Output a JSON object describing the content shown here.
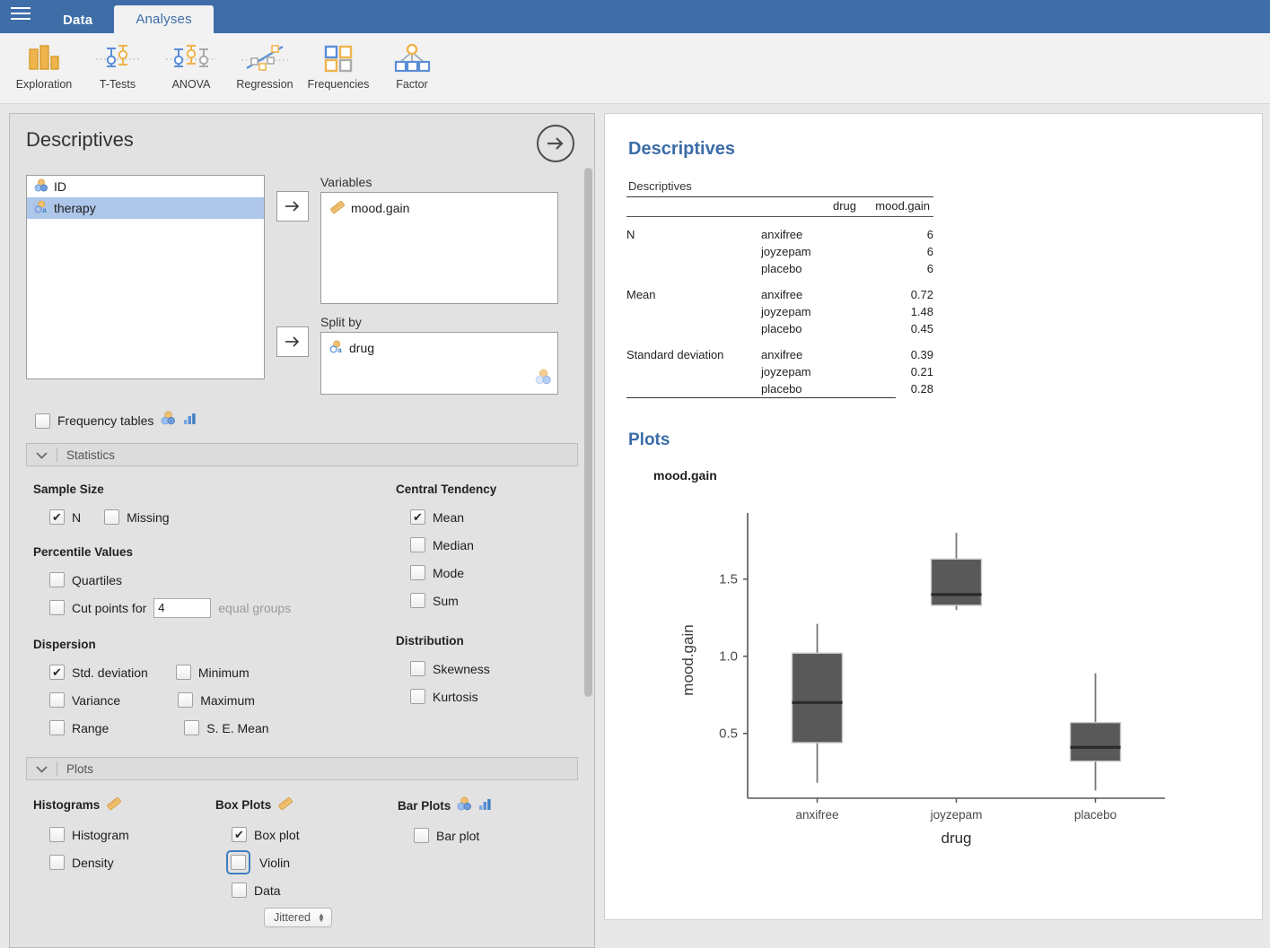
{
  "titlebar": {
    "menu_icon": "hamburger-icon",
    "tabs": [
      {
        "label": "Data",
        "active": false
      },
      {
        "label": "Analyses",
        "active": true
      }
    ]
  },
  "ribbon": {
    "buttons": [
      {
        "label": "Exploration",
        "icon": "bar-chart-icon"
      },
      {
        "label": "T-Tests",
        "icon": "error-bars-two-icon"
      },
      {
        "label": "ANOVA",
        "icon": "error-bars-three-icon"
      },
      {
        "label": "Regression",
        "icon": "scatter-line-icon"
      },
      {
        "label": "Frequencies",
        "icon": "four-squares-icon"
      },
      {
        "label": "Factor",
        "icon": "factor-tree-icon"
      }
    ]
  },
  "options": {
    "title": "Descriptives",
    "forward_icon": "arrow-right-circle-icon",
    "available_variables": [
      {
        "name": "ID",
        "type_icon": "nominal-icon",
        "selected": false
      },
      {
        "name": "therapy",
        "type_icon": "nominal-text-icon",
        "selected": true
      }
    ],
    "variables_box": {
      "label": "Variables",
      "items": [
        {
          "name": "mood.gain",
          "type_icon": "continuous-icon"
        }
      ]
    },
    "split_by_box": {
      "label": "Split by",
      "items": [
        {
          "name": "drug",
          "type_icon": "nominal-text-icon"
        }
      ],
      "permitted_icon": "nominal-icon"
    },
    "frequency_tables": {
      "label": "Frequency tables",
      "checked": false,
      "icons": [
        "nominal-icon",
        "bar-chart-small-icon"
      ]
    },
    "sections": {
      "statistics": {
        "label": "Statistics",
        "chevron": "chevron-down-icon",
        "expanded": true
      },
      "plots": {
        "label": "Plots",
        "chevron": "chevron-down-icon",
        "expanded": true
      }
    },
    "statistics": {
      "sample_size": {
        "title": "Sample Size",
        "items": [
          {
            "label": "N",
            "checked": true
          },
          {
            "label": "Missing",
            "checked": false
          }
        ]
      },
      "percentile_values": {
        "title": "Percentile Values",
        "items": [
          {
            "label": "Quartiles",
            "checked": false
          },
          {
            "label": "Cut points for",
            "checked": false
          }
        ],
        "cut_points_value": "4",
        "cut_points_suffix": "equal groups"
      },
      "dispersion": {
        "title": "Dispersion",
        "items": [
          {
            "label": "Std. deviation",
            "checked": true
          },
          {
            "label": "Minimum",
            "checked": false
          },
          {
            "label": "Variance",
            "checked": false
          },
          {
            "label": "Maximum",
            "checked": false
          },
          {
            "label": "Range",
            "checked": false
          },
          {
            "label": "S. E. Mean",
            "checked": false
          }
        ]
      },
      "central_tendency": {
        "title": "Central Tendency",
        "items": [
          {
            "label": "Mean",
            "checked": true
          },
          {
            "label": "Median",
            "checked": false
          },
          {
            "label": "Mode",
            "checked": false
          },
          {
            "label": "Sum",
            "checked": false
          }
        ]
      },
      "distribution": {
        "title": "Distribution",
        "items": [
          {
            "label": "Skewness",
            "checked": false
          },
          {
            "label": "Kurtosis",
            "checked": false
          }
        ]
      }
    },
    "plots": {
      "histograms": {
        "title": "Histograms",
        "icons": [
          "continuous-icon"
        ],
        "items": [
          {
            "label": "Histogram",
            "checked": false
          },
          {
            "label": "Density",
            "checked": false
          }
        ]
      },
      "box_plots": {
        "title": "Box Plots",
        "icons": [
          "continuous-icon"
        ],
        "items": [
          {
            "label": "Box plot",
            "checked": true,
            "focused": false
          },
          {
            "label": "Violin",
            "checked": false,
            "focused": true
          },
          {
            "label": "Data",
            "checked": false,
            "focused": false
          }
        ],
        "data_style_value": "Jittered"
      },
      "bar_plots": {
        "title": "Bar Plots",
        "icons": [
          "nominal-icon",
          "bar-chart-small-icon"
        ],
        "items": [
          {
            "label": "Bar plot",
            "checked": false
          }
        ]
      }
    }
  },
  "results": {
    "heading": "Descriptives",
    "table": {
      "caption": "Descriptives",
      "columns": [
        "",
        "drug",
        "mood.gain"
      ],
      "groups": [
        {
          "stat": "N",
          "rows": [
            {
              "drug": "anxifree",
              "value": "6"
            },
            {
              "drug": "joyzepam",
              "value": "6"
            },
            {
              "drug": "placebo",
              "value": "6"
            }
          ]
        },
        {
          "stat": "Mean",
          "rows": [
            {
              "drug": "anxifree",
              "value": "0.72"
            },
            {
              "drug": "joyzepam",
              "value": "1.48"
            },
            {
              "drug": "placebo",
              "value": "0.45"
            }
          ]
        },
        {
          "stat": "Standard deviation",
          "rows": [
            {
              "drug": "anxifree",
              "value": "0.39"
            },
            {
              "drug": "joyzepam",
              "value": "0.21"
            },
            {
              "drug": "placebo",
              "value": "0.28"
            }
          ]
        }
      ]
    },
    "plots_heading": "Plots",
    "plot_title": "mood.gain"
  },
  "chart_data": {
    "type": "boxplot",
    "title": "mood.gain",
    "xlabel": "drug",
    "ylabel": "mood.gain",
    "categories": [
      "anxifree",
      "joyzepam",
      "placebo"
    ],
    "yticks": [
      0.5,
      1.0,
      1.5
    ],
    "ylim": [
      0.08,
      1.87
    ],
    "grid": false,
    "legend": "none",
    "box_color": "#595959",
    "series": [
      {
        "name": "anxifree",
        "whisker_low": 0.18,
        "q1": 0.44,
        "median": 0.7,
        "q3": 1.02,
        "whisker_high": 1.21,
        "mean": 0.72,
        "sd": 0.39,
        "n": 6
      },
      {
        "name": "joyzepam",
        "whisker_low": 1.3,
        "q1": 1.33,
        "median": 1.4,
        "q3": 1.63,
        "whisker_high": 1.8,
        "mean": 1.48,
        "sd": 0.21,
        "n": 6
      },
      {
        "name": "placebo",
        "whisker_low": 0.13,
        "q1": 0.32,
        "median": 0.41,
        "q3": 0.57,
        "whisker_high": 0.89,
        "mean": 0.45,
        "sd": 0.28,
        "n": 6
      }
    ]
  },
  "colors": {
    "titlebar": "#3e6da8",
    "accent_heading": "#3b6ca8",
    "selection": "#aec6ea",
    "focus_ring": "#3f7fc1",
    "icon_orange": "#efb44b",
    "icon_blue": "#5b8dd6",
    "icon_grey": "#aaaaaa"
  }
}
